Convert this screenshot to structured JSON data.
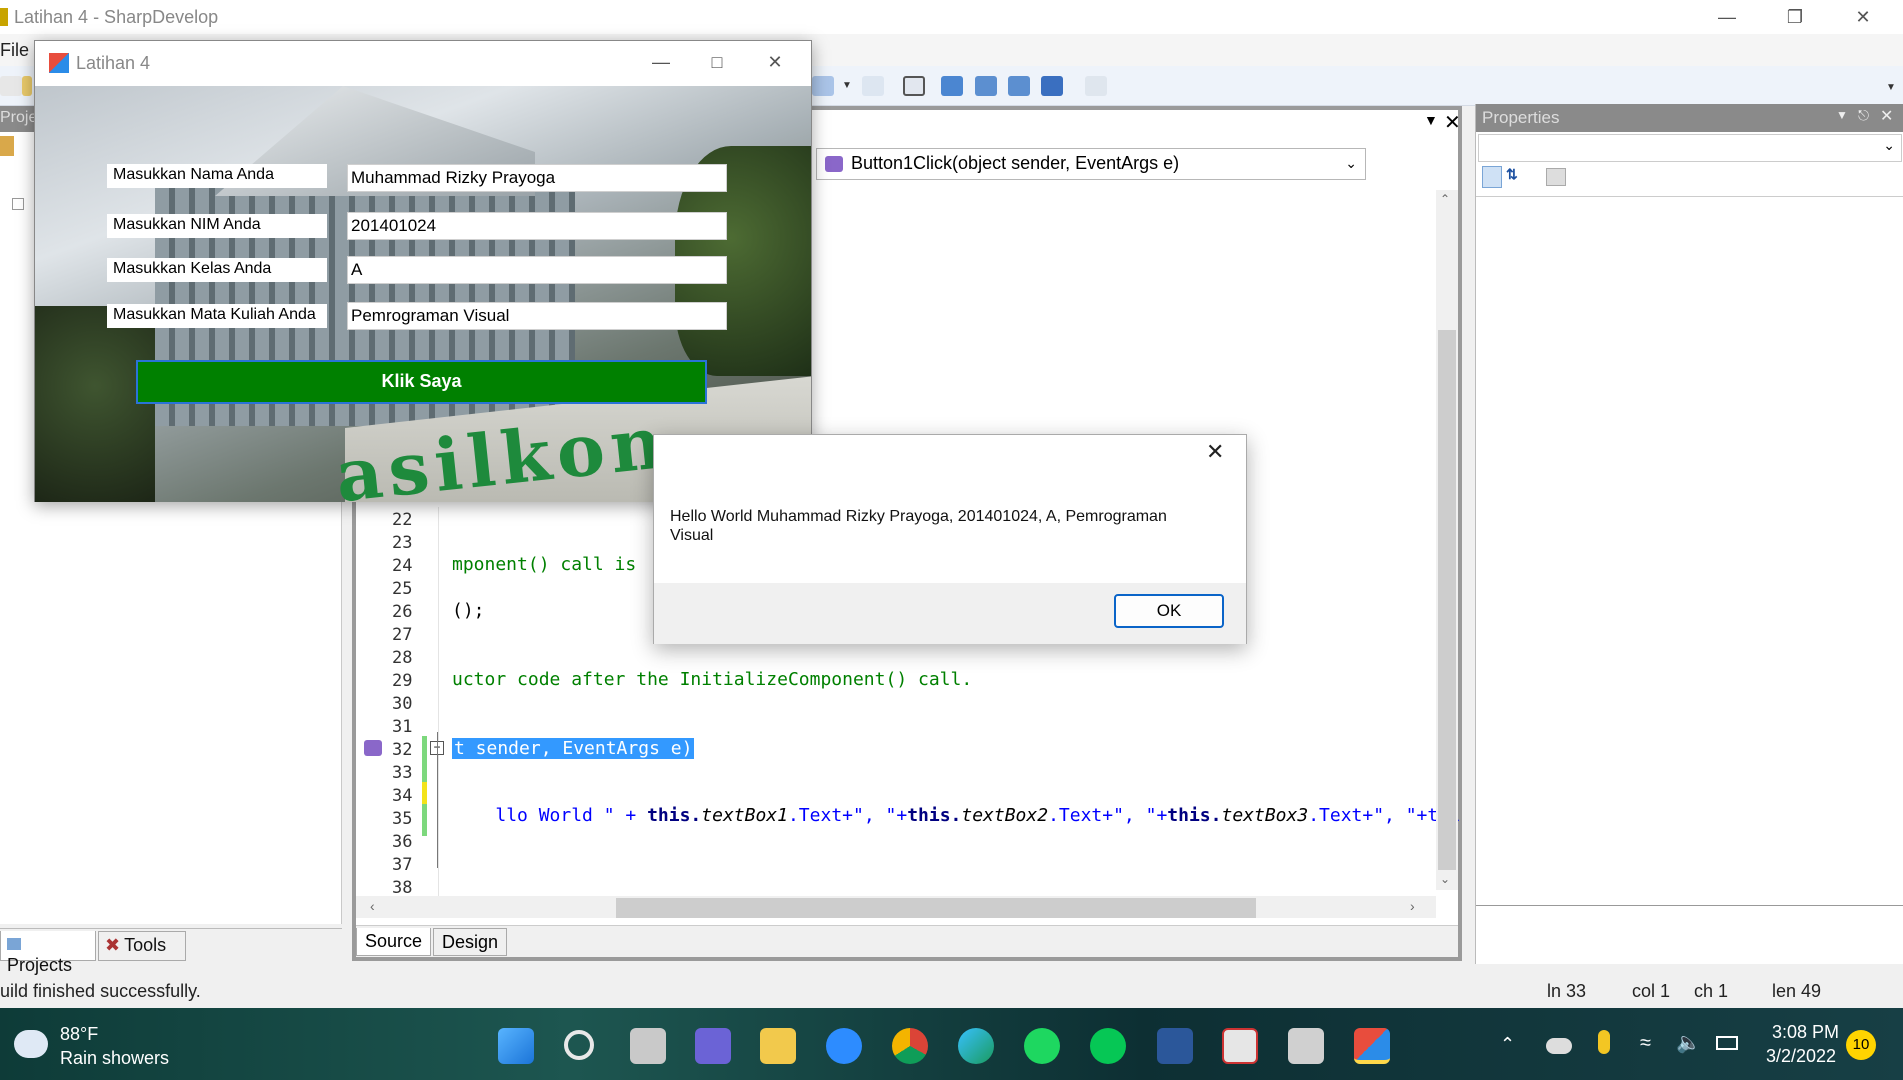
{
  "window": {
    "title": "Latihan 4 - SharpDevelop",
    "menu_file": "File"
  },
  "left_pane": {
    "header": "Projec",
    "tabs": [
      "Projects",
      "Tools"
    ]
  },
  "editor": {
    "method_combo": "Button1Click(object sender, EventArgs e)",
    "line_numbers": [
      "22",
      "23",
      "24",
      "25",
      "26",
      "27",
      "28",
      "29",
      "30",
      "31",
      "32",
      "33",
      "34",
      "35",
      "36",
      "37",
      "38"
    ],
    "code_lines": {
      "l24": "mponent() call is",
      "l26": "();",
      "l29": "uctor code after the InitializeComponent() call.",
      "l32": "t sender, EventArgs e)",
      "l34_a": "llo World \" + ",
      "l34_b": "this.",
      "l34_c": "textBox1",
      "l34_d": ".Text+\", \"+",
      "l34_e": "this.",
      "l34_f": "textBox2",
      "l34_g": ".Text+\", \"+",
      "l34_h": "this.",
      "l34_i": "textBox3",
      "l34_j": ".Text+\", \"+thi"
    },
    "tabs": [
      "Source",
      "Design"
    ]
  },
  "properties": {
    "header": "Properties"
  },
  "statusbar": {
    "message": "uild finished successfully.",
    "ln": "ln 33",
    "col": "col 1",
    "ch": "ch 1",
    "len": "len 49"
  },
  "form": {
    "title": "Latihan 4",
    "fields": [
      {
        "label": "Masukkan Nama Anda",
        "value": "Muhammad Rizky Prayoga"
      },
      {
        "label": "Masukkan NIM Anda",
        "value": "201401024"
      },
      {
        "label": "Masukkan Kelas Anda",
        "value": "A"
      },
      {
        "label": "Masukkan Mata Kuliah Anda",
        "value": "Pemrograman Visual"
      }
    ],
    "button": "Klik Saya",
    "bg_text": "asilkon"
  },
  "message_box": {
    "text": "Hello World Muhammad Rizky Prayoga, 201401024, A, Pemrograman Visual",
    "ok": "OK"
  },
  "taskbar": {
    "weather_temp": "88°F",
    "weather_desc": "Rain showers",
    "time": "3:08 PM",
    "date": "3/2/2022",
    "notifications": "10"
  },
  "colors": {
    "button_green": "#008000",
    "selection_blue": "#3399ff",
    "code_green": "#008000",
    "keyword_blue": "#0000ff"
  }
}
